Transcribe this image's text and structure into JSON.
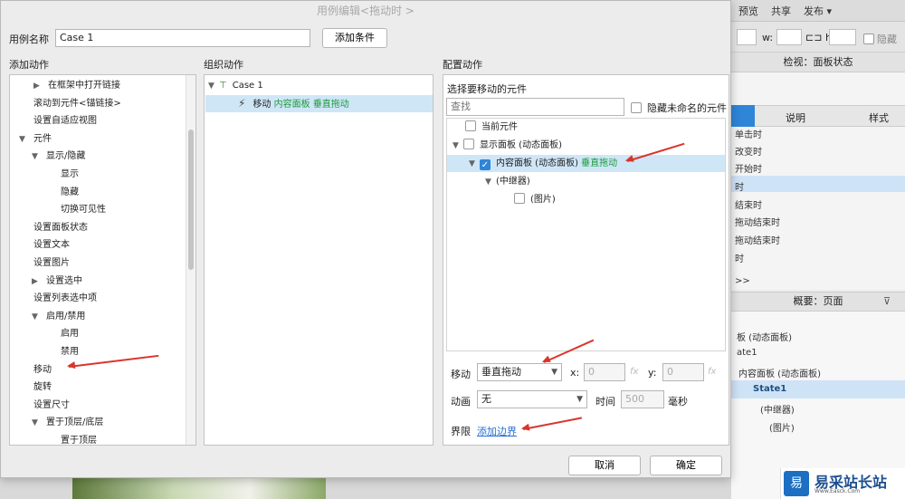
{
  "background": {
    "toolbar": {
      "preview": "预览",
      "share": "共享",
      "publish": "发布 ▾"
    },
    "format_row": {
      "w_label": "w:",
      "h_label": "h:",
      "hide_label": "隐藏"
    },
    "inspector": {
      "title": "检视：面板状态",
      "tabs": [
        "说明",
        "样式"
      ],
      "events": [
        "单击时",
        "改变时",
        "开始时",
        "时",
        "结束时",
        "拖动结束时",
        "拖动结束时",
        "时"
      ],
      "more": ">>"
    },
    "outline": {
      "title": "概要：页面",
      "rows": [
        "板 (动态面板)",
        "ate1",
        "内容面板 (动态面板)",
        "State1",
        "(中继器)",
        "(图片)"
      ]
    },
    "watermark": {
      "logo": "易",
      "name": "易采站长站",
      "sub": "Www.Easck.Com"
    }
  },
  "dialog": {
    "title": "用例编辑<拖动时 >",
    "case_name_label": "用例名称",
    "case_name_value": "Case 1",
    "add_condition": "添加条件",
    "add_action_title": "添加动作",
    "organize_title": "组织动作",
    "configure_title": "配置动作",
    "add_actions": [
      {
        "label": "在框架中打开链接",
        "indent": 2,
        "tri": "▶"
      },
      {
        "label": "滚动到元件<锚链接>",
        "indent": 2,
        "tri": ""
      },
      {
        "label": "设置自适应视图",
        "indent": 2,
        "tri": ""
      },
      {
        "label": "元件",
        "indent": 0,
        "tri": "▼"
      },
      {
        "label": "显示/隐藏",
        "indent": 1,
        "tri": "▼"
      },
      {
        "label": "显示",
        "indent": 3,
        "tri": ""
      },
      {
        "label": "隐藏",
        "indent": 3,
        "tri": ""
      },
      {
        "label": "切换可见性",
        "indent": 3,
        "tri": ""
      },
      {
        "label": "设置面板状态",
        "indent": 2,
        "tri": ""
      },
      {
        "label": "设置文本",
        "indent": 2,
        "tri": ""
      },
      {
        "label": "设置图片",
        "indent": 2,
        "tri": ""
      },
      {
        "label": "设置选中",
        "indent": 1,
        "tri": "▶"
      },
      {
        "label": "设置列表选中项",
        "indent": 2,
        "tri": ""
      },
      {
        "label": "启用/禁用",
        "indent": 1,
        "tri": "▼"
      },
      {
        "label": "启用",
        "indent": 3,
        "tri": ""
      },
      {
        "label": "禁用",
        "indent": 3,
        "tri": ""
      },
      {
        "label": "移动",
        "indent": 2,
        "tri": ""
      },
      {
        "label": "旋转",
        "indent": 2,
        "tri": ""
      },
      {
        "label": "设置尺寸",
        "indent": 2,
        "tri": ""
      },
      {
        "label": "置于顶层/底层",
        "indent": 1,
        "tri": "▼"
      },
      {
        "label": "置于顶层",
        "indent": 3,
        "tri": ""
      }
    ],
    "organize": {
      "case_label": "Case 1",
      "action_verb": "移动",
      "action_target": "内容面板",
      "action_detail": "垂直拖动"
    },
    "configure": {
      "select_label": "选择要移动的元件",
      "search_placeholder": "查找",
      "hide_unnamed": "隐藏未命名的元件",
      "tree": {
        "current": "当前元件",
        "display_panel": "显示面板 (动态面板)",
        "content_panel": "内容面板 (动态面板)",
        "content_panel_detail": "垂直拖动",
        "repeater": "(中继器)",
        "image": "(图片)"
      },
      "move_label": "移动",
      "move_value": "垂直拖动",
      "x_label": "x:",
      "x_value": "0",
      "y_label": "y:",
      "y_value": "0",
      "fx": "fx",
      "anim_label": "动画",
      "anim_value": "无",
      "time_label": "时间",
      "time_value": "500",
      "ms_label": "毫秒",
      "bounds_label": "界限",
      "add_bounds": "添加边界"
    },
    "cancel": "取消",
    "ok": "确定"
  }
}
